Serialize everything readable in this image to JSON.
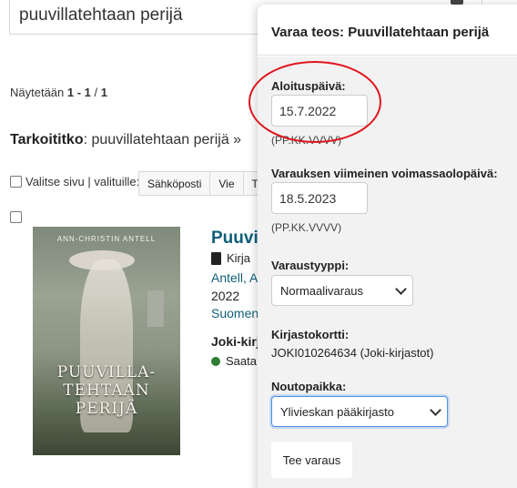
{
  "search": {
    "query": "puuvillatehtaan perijä"
  },
  "results": {
    "count_prefix": "Näytetään ",
    "count_range": "1 - 1",
    "count_total": "1",
    "did_you_mean_label": "Tarkoititko",
    "did_you_mean_value": ": puuvillatehtaan perijä »",
    "select_page_label": "Valitse sivu | valituille:",
    "toolbar": [
      "Sähköposti",
      "Vie",
      "T"
    ]
  },
  "record": {
    "cover_author": "ANN-CHRISTIN ANTELL",
    "cover_title_line1": "PUUVILLA-",
    "cover_title_line2": "TEHTAAN",
    "cover_title_line3": "PERIJÄ",
    "title": "Puuvi",
    "format": "Kirja",
    "author": "Antell, A",
    "year": "2022",
    "language": "Suomen",
    "library": "Joki-kirj",
    "availability": "Saata",
    "availability_color": "#2e7d32"
  },
  "modal": {
    "title": "Varaa teos: Puuvillatehtaan perijä",
    "start_date_label": "Aloituspäivä:",
    "start_date_value": "15.7.2022",
    "start_date_hint": "(PP.KK.VVVV)",
    "end_date_label": "Varauksen viimeinen voimassaolopäivä:",
    "end_date_value": "18.5.2023",
    "end_date_hint": "(PP.KK.VVVV)",
    "hold_type_label": "Varaustyyppi:",
    "hold_type_value": "Normaalivaraus",
    "library_card_label": "Kirjastokortti:",
    "library_card_value": "JOKI010264634 (Joki-kirjastot)",
    "pickup_label": "Noutopaikka:",
    "pickup_value": "Ylivieskan pääkirjasto",
    "submit_label": "Tee varaus"
  },
  "colors": {
    "link": "#0f5f7a",
    "highlight_ring": "#e0151c",
    "focus": "#4a90e2"
  }
}
